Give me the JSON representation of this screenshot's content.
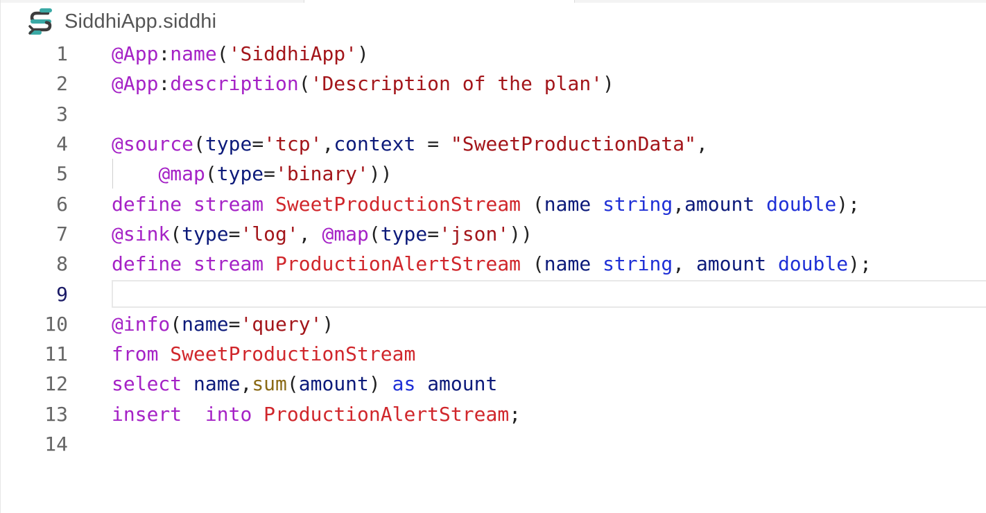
{
  "tab": {
    "file_name": "SiddhiApp.siddhi",
    "icon": "siddhi-logo-icon"
  },
  "colors": {
    "annotation": "#a522c6",
    "string": "#a3151a",
    "stream_name": "#d0262b",
    "type": "#1e2fd6",
    "identifier": "#0c1a7a",
    "logo_teal": "#3aa9a5",
    "logo_dark": "#3d3d3d"
  },
  "editor": {
    "active_line": 9,
    "lines": [
      {
        "number": "1",
        "tokens": [
          {
            "t": "@App",
            "c": "anno"
          },
          {
            "t": ":",
            "c": "punc"
          },
          {
            "t": "name",
            "c": "anno"
          },
          {
            "t": "(",
            "c": "punc"
          },
          {
            "t": "'SiddhiApp'",
            "c": "str"
          },
          {
            "t": ")",
            "c": "punc"
          }
        ]
      },
      {
        "number": "2",
        "tokens": [
          {
            "t": "@App",
            "c": "anno"
          },
          {
            "t": ":",
            "c": "punc"
          },
          {
            "t": "description",
            "c": "anno"
          },
          {
            "t": "(",
            "c": "punc"
          },
          {
            "t": "'Description of the plan'",
            "c": "str"
          },
          {
            "t": ")",
            "c": "punc"
          }
        ]
      },
      {
        "number": "3",
        "tokens": []
      },
      {
        "number": "4",
        "tokens": [
          {
            "t": "@source",
            "c": "anno"
          },
          {
            "t": "(",
            "c": "punc"
          },
          {
            "t": "type",
            "c": "id"
          },
          {
            "t": "=",
            "c": "punc"
          },
          {
            "t": "'tcp'",
            "c": "str"
          },
          {
            "t": ",",
            "c": "punc"
          },
          {
            "t": "context",
            "c": "id"
          },
          {
            "t": " = ",
            "c": "punc"
          },
          {
            "t": "\"SweetProductionData\"",
            "c": "str"
          },
          {
            "t": ",",
            "c": "punc"
          }
        ]
      },
      {
        "number": "5",
        "tokens": [
          {
            "t": "    ",
            "c": "punc"
          },
          {
            "t": "@map",
            "c": "anno"
          },
          {
            "t": "(",
            "c": "punc"
          },
          {
            "t": "type",
            "c": "id"
          },
          {
            "t": "=",
            "c": "punc"
          },
          {
            "t": "'binary'",
            "c": "str"
          },
          {
            "t": "))",
            "c": "punc"
          }
        ]
      },
      {
        "number": "6",
        "tokens": [
          {
            "t": "define",
            "c": "kw"
          },
          {
            "t": " ",
            "c": "punc"
          },
          {
            "t": "stream",
            "c": "kw"
          },
          {
            "t": " ",
            "c": "punc"
          },
          {
            "t": "SweetProductionStream",
            "c": "cls"
          },
          {
            "t": " (",
            "c": "punc"
          },
          {
            "t": "name",
            "c": "id"
          },
          {
            "t": " ",
            "c": "punc"
          },
          {
            "t": "string",
            "c": "type"
          },
          {
            "t": ",",
            "c": "punc"
          },
          {
            "t": "amount",
            "c": "id"
          },
          {
            "t": " ",
            "c": "punc"
          },
          {
            "t": "double",
            "c": "type"
          },
          {
            "t": ");",
            "c": "punc"
          }
        ]
      },
      {
        "number": "7",
        "tokens": [
          {
            "t": "@sink",
            "c": "anno"
          },
          {
            "t": "(",
            "c": "punc"
          },
          {
            "t": "type",
            "c": "id"
          },
          {
            "t": "=",
            "c": "punc"
          },
          {
            "t": "'log'",
            "c": "str"
          },
          {
            "t": ", ",
            "c": "punc"
          },
          {
            "t": "@map",
            "c": "anno"
          },
          {
            "t": "(",
            "c": "punc"
          },
          {
            "t": "type",
            "c": "id"
          },
          {
            "t": "=",
            "c": "punc"
          },
          {
            "t": "'json'",
            "c": "str"
          },
          {
            "t": "))",
            "c": "punc"
          }
        ]
      },
      {
        "number": "8",
        "tokens": [
          {
            "t": "define",
            "c": "kw"
          },
          {
            "t": " ",
            "c": "punc"
          },
          {
            "t": "stream",
            "c": "kw"
          },
          {
            "t": " ",
            "c": "punc"
          },
          {
            "t": "ProductionAlertStream",
            "c": "cls"
          },
          {
            "t": " (",
            "c": "punc"
          },
          {
            "t": "name",
            "c": "id"
          },
          {
            "t": " ",
            "c": "punc"
          },
          {
            "t": "string",
            "c": "type"
          },
          {
            "t": ", ",
            "c": "punc"
          },
          {
            "t": "amount",
            "c": "id"
          },
          {
            "t": " ",
            "c": "punc"
          },
          {
            "t": "double",
            "c": "type"
          },
          {
            "t": ");",
            "c": "punc"
          }
        ]
      },
      {
        "number": "9",
        "tokens": []
      },
      {
        "number": "10",
        "tokens": [
          {
            "t": "@info",
            "c": "anno"
          },
          {
            "t": "(",
            "c": "punc"
          },
          {
            "t": "name",
            "c": "id"
          },
          {
            "t": "=",
            "c": "punc"
          },
          {
            "t": "'query'",
            "c": "str"
          },
          {
            "t": ")",
            "c": "punc"
          }
        ]
      },
      {
        "number": "11",
        "tokens": [
          {
            "t": "from",
            "c": "kw"
          },
          {
            "t": " ",
            "c": "punc"
          },
          {
            "t": "SweetProductionStream",
            "c": "cls"
          }
        ]
      },
      {
        "number": "12",
        "tokens": [
          {
            "t": "select",
            "c": "kw"
          },
          {
            "t": " ",
            "c": "punc"
          },
          {
            "t": "name",
            "c": "id"
          },
          {
            "t": ",",
            "c": "punc"
          },
          {
            "t": "sum",
            "c": "fn"
          },
          {
            "t": "(",
            "c": "punc"
          },
          {
            "t": "amount",
            "c": "id"
          },
          {
            "t": ") ",
            "c": "punc"
          },
          {
            "t": "as",
            "c": "as"
          },
          {
            "t": " ",
            "c": "punc"
          },
          {
            "t": "amount",
            "c": "id"
          }
        ]
      },
      {
        "number": "13",
        "tokens": [
          {
            "t": "insert",
            "c": "kw"
          },
          {
            "t": "  ",
            "c": "punc"
          },
          {
            "t": "into",
            "c": "kw"
          },
          {
            "t": " ",
            "c": "punc"
          },
          {
            "t": "ProductionAlertStream",
            "c": "cls"
          },
          {
            "t": ";",
            "c": "punc"
          }
        ]
      },
      {
        "number": "14",
        "tokens": []
      }
    ]
  }
}
